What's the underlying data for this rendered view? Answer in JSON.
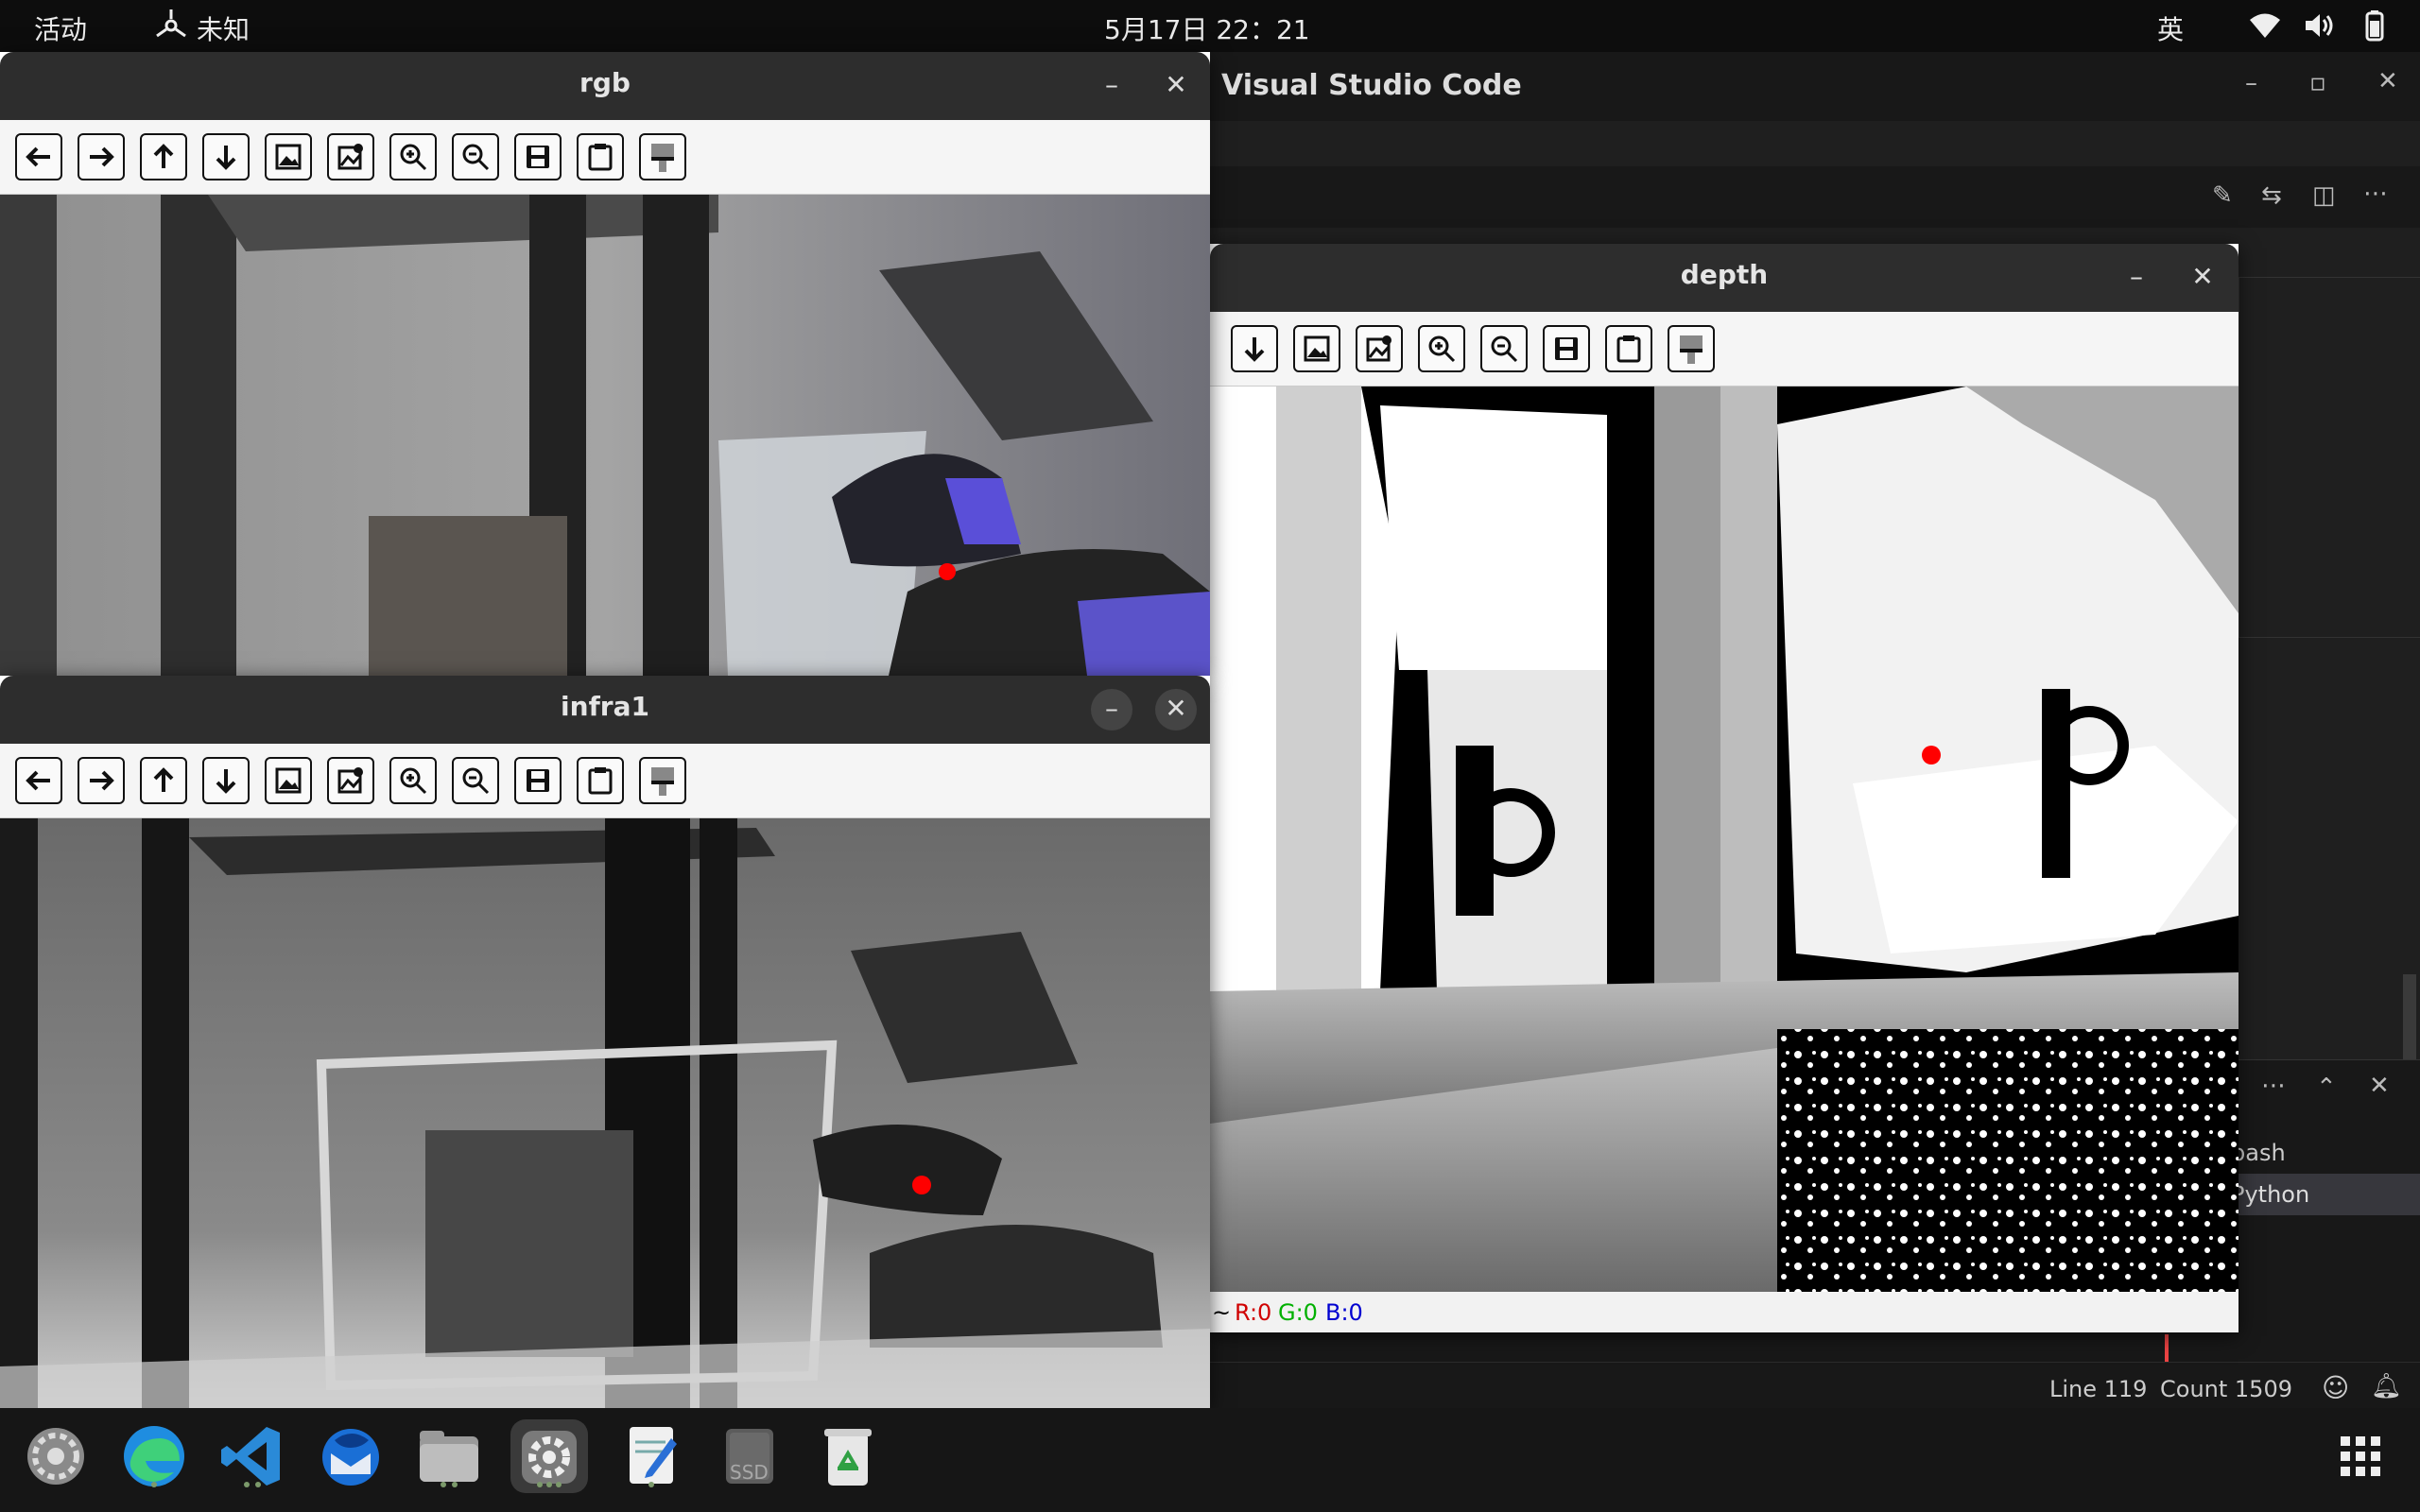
{
  "topbar": {
    "activities": "活动",
    "app_menu": "未知",
    "clock": "5月17日  22：21",
    "input_method": "英"
  },
  "vscode": {
    "title": "Visual Studio Code",
    "panel": {
      "term_bash": "bash",
      "term_python": "Python"
    },
    "status": {
      "line": "Line 119",
      "count": "Count 1509"
    }
  },
  "windows": {
    "rgb": {
      "title": "rgb"
    },
    "infra1": {
      "title": "infra1"
    },
    "depth": {
      "title": "depth",
      "status_prefix": "~",
      "r": "R:0",
      "g": "G:0",
      "b": "B:0"
    }
  },
  "toolbar_icons": [
    "arrow-left-icon",
    "arrow-right-icon",
    "arrow-up-icon",
    "arrow-down-icon",
    "image-icon",
    "image-adjust-icon",
    "zoom-in-icon",
    "zoom-out-icon",
    "save-icon",
    "clipboard-icon",
    "brush-icon"
  ],
  "dock": {
    "ssd_label": "SSD"
  },
  "colors": {
    "red_marker": "#ff0000",
    "r_text": "#d00000",
    "g_text": "#00b000",
    "b_text": "#0000d0"
  }
}
